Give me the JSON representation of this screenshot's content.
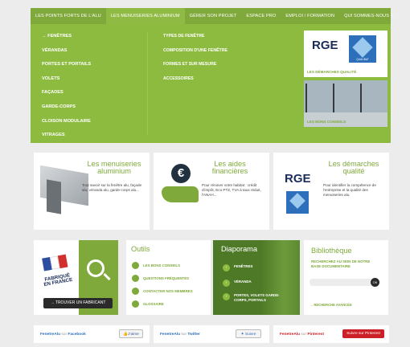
{
  "topnav": {
    "tabs": [
      "LES POINTS FORTS DE L'ALU",
      "LES MENUISERIES ALUMINIUM",
      "GÉRER SON PROJET",
      "ESPACE PRO",
      "EMPLOI / FORMATION",
      "QUI SOMMES-NOUS ?"
    ],
    "active_index": 1
  },
  "mega": {
    "col1": [
      "→ FENÊTRES",
      "VÉRANDAS",
      "PORTES ET PORTAILS",
      "VOLETS",
      "FAÇADES",
      "GARDE-CORPS",
      "CLOISON MODULAIRE",
      "VITRAGES"
    ],
    "col2": [
      "TYPES DE FENÊTRE",
      "COMPOSITION D'UNE FENÊTRE",
      "FORMES ET SUR MESURE",
      "ACCESSOIRES"
    ],
    "promo1": {
      "logo": "RGE",
      "badge": "QUALIBAT",
      "caption": "LES DÉMARCHES QUALITÉ"
    },
    "promo2": {
      "caption": "LES BONS CONSEILS"
    }
  },
  "cards": [
    {
      "title": "Les menuiseries aluminium",
      "text": "Tout savoir sur la fenêtre alu, façade alu, véranda alu, garde-corps alu..."
    },
    {
      "title": "Les aides financières",
      "text": "Pour rénover votre habitat : crédit d'impôt, Eco PTZ, TVA à taux réduit, l'ANAH..."
    },
    {
      "title": "Les démarches qualité",
      "text": "Pour identifier la compétence de l'entreprise et la qualité des menuiseries alu.",
      "logo": "RGE",
      "badge": "QUALIBAT"
    }
  ],
  "fabricant": {
    "flag_label": "FABRIQUÉ EN FRANCE",
    "button": "→ TROUVER UN FABRICANT"
  },
  "outils": {
    "title": "Outils",
    "items": [
      "LES BONS CONSEILS",
      "QUESTIONS FRÉQUENTES",
      "CONTACTER NOS MEMBRES",
      "GLOSSAIRE"
    ]
  },
  "diaporama": {
    "title": "Diaporama",
    "items": [
      "FENÊTRES",
      "VÉRANDA",
      "PORTES, VOLETS GARDE-CORPS, PORTAILS"
    ]
  },
  "bibliotheque": {
    "title": "Bibliothèque",
    "desc": "RECHERCHEZ AU SEIN DE NOTRE BASE DOCUMENTAIRE",
    "ok": "OK",
    "advanced": "→ RECHERCHE AVANCÉE"
  },
  "social": {
    "facebook": {
      "brand": "FenetreAlu",
      "sur": "sur",
      "network": "Facebook",
      "button": "J'aime"
    },
    "twitter": {
      "brand": "FenetreAlu",
      "sur": "sur",
      "network": "Twitter",
      "button": "Suivre"
    },
    "pinterest": {
      "brand": "FenetreAlu",
      "sur": "sur",
      "network": "Pinterest",
      "button": "Suivre sur Pinterest"
    }
  },
  "colors": {
    "green": "#7fa93a",
    "green_light": "#8dbb3f",
    "navy": "#1a2c5b",
    "blue": "#2d6fba",
    "pinterest": "#cb2027"
  }
}
